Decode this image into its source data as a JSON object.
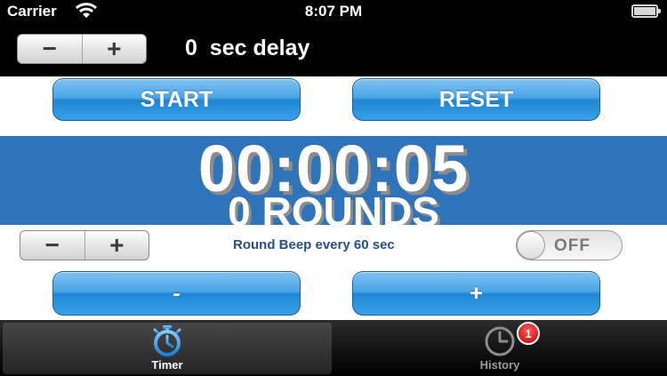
{
  "status_bar": {
    "carrier": "Carrier",
    "time": "8:07 PM"
  },
  "delay_bar": {
    "minus": "−",
    "plus": "+",
    "label": "0  sec delay"
  },
  "controls": {
    "start": "START",
    "reset": "RESET",
    "decrease": "-",
    "increase": "+"
  },
  "display": {
    "clock": "00:00:05",
    "rounds": "0 ROUNDS"
  },
  "beep": {
    "minus": "−",
    "plus": "+",
    "label": "Round Beep every 60 sec",
    "toggle_state": "OFF"
  },
  "tabbar": {
    "tabs": [
      {
        "label": "Timer",
        "icon": "stopwatch-icon",
        "active": true
      },
      {
        "label": "History",
        "icon": "clock-icon",
        "active": false,
        "badge": "1"
      }
    ]
  },
  "colors": {
    "display_bg": "#2f73bb",
    "button_blue": "#3aa0e8",
    "beep_text": "#274f86"
  }
}
